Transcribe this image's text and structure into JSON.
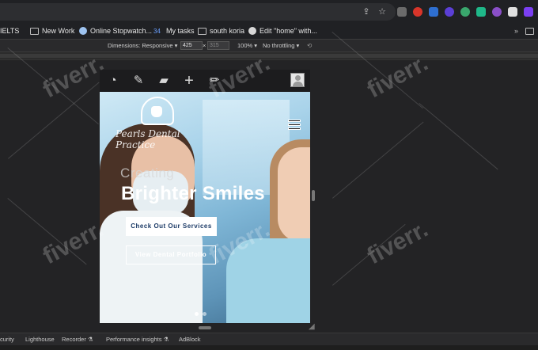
{
  "bookmarks": [
    {
      "label": "IELTS",
      "icon": "folder-icon"
    },
    {
      "label": "New Work",
      "icon": "folder-icon"
    },
    {
      "label": "Online Stopwatch...",
      "icon": "stopwatch-icon"
    },
    {
      "label": "My tasks",
      "icon": "tasks-icon"
    },
    {
      "label": "south koria",
      "icon": "folder-icon"
    },
    {
      "label": "Edit \"home\" with...",
      "icon": "wordpress-icon"
    }
  ],
  "device_toolbar": {
    "dimensions_label": "Dimensions: Responsive",
    "width_value": "425",
    "separator": "×",
    "height_value": "315",
    "zoom_label": "100%",
    "throttle_label": "No throttling"
  },
  "wp_toolbar_icons": [
    "dashboard-icon",
    "brush-icon",
    "comment-icon",
    "plus-icon",
    "pencil-icon",
    "user-avatar-icon"
  ],
  "site": {
    "logo_text": "Pearls Dental Practice",
    "hero_small": "Creating",
    "hero_big": "Brighter Smiles",
    "primary_button": "Check Out Our Services",
    "secondary_button": "View Dental Portfolio"
  },
  "devtools_tabs": [
    "curity",
    "Lighthouse",
    "Recorder ⚗",
    "Performance insights ⚗",
    "AdBlock"
  ],
  "watermark_text": "fiverr.",
  "colors": {
    "primary_button_text": "#1b3a66",
    "page_bg": "#202124"
  }
}
